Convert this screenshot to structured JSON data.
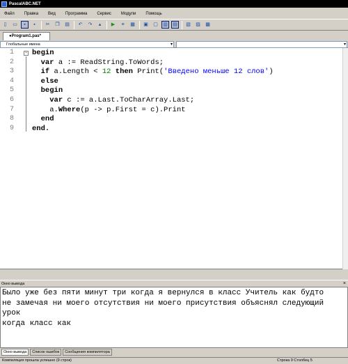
{
  "window": {
    "title": "PascalABC.NET"
  },
  "menu": [
    "Файл",
    "Правка",
    "Вид",
    "Программа",
    "Сервис",
    "Модули",
    "Помощь"
  ],
  "toolbar": {
    "icons": [
      "new-file-icon",
      "open-folder-icon",
      "save-icon",
      "save-all-icon",
      "cut-icon",
      "copy-icon",
      "paste-icon",
      "undo-icon",
      "redo-icon",
      "bookmark-icon",
      "run-icon",
      "step-icon",
      "debug-icon",
      "form-icon",
      "output-window-icon",
      "panel-icon",
      "compile-icon",
      "document-icon",
      "debug-output-icon",
      "options-icon"
    ]
  },
  "editor": {
    "tab_label": "●Program1.pas*",
    "left_combo": "Глобальные имена",
    "right_combo": "",
    "line_numbers": [
      "1",
      "2",
      "3",
      "4",
      "5",
      "6",
      "7",
      "8",
      "9"
    ],
    "lines": [
      {
        "segments": [
          {
            "t": "begin",
            "c": "kw"
          }
        ]
      },
      {
        "segments": [
          {
            "t": "  "
          },
          {
            "t": "var",
            "c": "kw"
          },
          {
            "t": " a := ReadString.ToWords;"
          }
        ]
      },
      {
        "segments": [
          {
            "t": "  "
          },
          {
            "t": "if",
            "c": "kw"
          },
          {
            "t": " a.Length < "
          },
          {
            "t": "12",
            "c": "num"
          },
          {
            "t": " "
          },
          {
            "t": "then",
            "c": "kw"
          },
          {
            "t": " Print("
          },
          {
            "t": "'Введено меньше 12 слов'",
            "c": "str"
          },
          {
            "t": ")"
          }
        ]
      },
      {
        "segments": [
          {
            "t": "  "
          },
          {
            "t": "else",
            "c": "kw"
          }
        ]
      },
      {
        "segments": [
          {
            "t": "  "
          },
          {
            "t": "begin",
            "c": "kw"
          }
        ]
      },
      {
        "segments": [
          {
            "t": "    "
          },
          {
            "t": "var",
            "c": "kw"
          },
          {
            "t": " c := a.Last.ToCharArray.Last;"
          }
        ]
      },
      {
        "segments": [
          {
            "t": "    a."
          },
          {
            "t": "Where",
            "c": "kw"
          },
          {
            "t": "(p -> p.First = c).Print"
          }
        ]
      },
      {
        "segments": [
          {
            "t": "  "
          },
          {
            "t": "end",
            "c": "kw"
          }
        ]
      },
      {
        "segments": [
          {
            "t": "end.",
            "c": "kw"
          }
        ]
      }
    ]
  },
  "output_panel": {
    "title": "Окно вывода",
    "close": "×",
    "lines": [
      "Было уже без пяти минут три когда я вернулся в класс Учитель как будто",
      "не замечая ни моего отсутствия ни моего присутствия объяснял следующий",
      "урок",
      "когда класс как"
    ]
  },
  "bottom_tabs": [
    "Окно вывода",
    "Список ошибок",
    "Сообщения компилятора"
  ],
  "status": {
    "message": "Компиляция прошла успешно (9 строк)",
    "position": "Строка  9  Столбец  5"
  }
}
